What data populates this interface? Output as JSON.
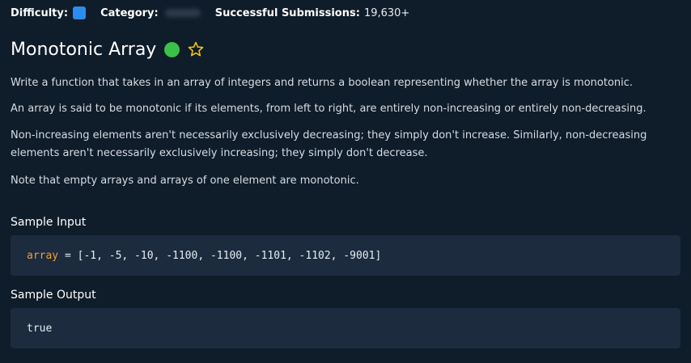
{
  "meta": {
    "difficulty_label": "Difficulty:",
    "category_label": "Category:",
    "submissions_label": "Successful Submissions:",
    "submissions_value": "19,630+"
  },
  "problem": {
    "title": "Monotonic Array",
    "paragraphs": [
      "Write a function that takes in an array of integers and returns a boolean representing whether the array is monotonic.",
      "An array is said to be monotonic if its elements, from left to right, are entirely non-increasing or entirely non-decreasing.",
      "Non-increasing elements aren't necessarily exclusively decreasing; they simply don't increase. Similarly, non-decreasing elements aren't necessarily exclusively increasing; they simply don't decrease.",
      "Note that empty arrays and arrays of one element are monotonic."
    ]
  },
  "sample_input": {
    "heading": "Sample Input",
    "var_name": "array",
    "rest": " = [-1, -5, -10, -1100, -1100, -1101, -1102, -9001]"
  },
  "sample_output": {
    "heading": "Sample Output",
    "value": "true"
  },
  "colors": {
    "background": "#0f1c29",
    "code_background": "#1c2b3d",
    "difficulty_badge": "#2d8cf0",
    "status_dot": "#3bc04a",
    "star": "#f5c518",
    "code_variable": "#f39c3c"
  },
  "icons": {
    "status": "completed-dot-icon",
    "favorite": "star-outline-icon"
  }
}
